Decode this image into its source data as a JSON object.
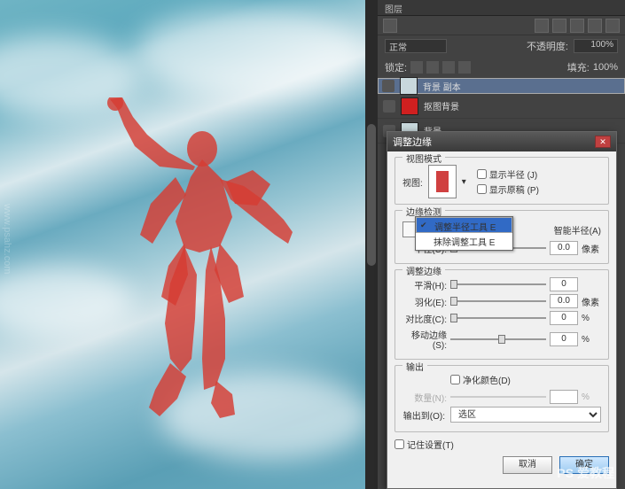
{
  "panel": {
    "tab": "图层",
    "blend_mode": "正常",
    "opacity_label": "不透明度:",
    "opacity_value": "100%",
    "lock_label": "锁定:",
    "fill_label": "填充:",
    "fill_value": "100%",
    "layers": [
      {
        "name": "背景 副本",
        "selected": true,
        "thumb": "#c8d8dc"
      },
      {
        "name": "抠图背景",
        "selected": false,
        "thumb": "#d02020"
      },
      {
        "name": "背景",
        "selected": false,
        "thumb": "#c8d8dc"
      }
    ]
  },
  "dialog": {
    "title": "调整边缘",
    "view": {
      "legend": "视图模式",
      "label": "视图:",
      "show_radius": "显示半径 (J)",
      "show_original": "显示原稿 (P)"
    },
    "detect": {
      "legend": "边缘检测",
      "tool_menu": [
        "调整半径工具   E",
        "抹除调整工具   E"
      ],
      "smart": "智能半径(A)",
      "radius_label": "半径(U):",
      "radius_value": "0.0",
      "radius_unit": "像素"
    },
    "adjust": {
      "legend": "调整边缘",
      "smooth_label": "平滑(H):",
      "smooth_value": "0",
      "feather_label": "羽化(E):",
      "feather_value": "0.0",
      "feather_unit": "像素",
      "contrast_label": "对比度(C):",
      "contrast_value": "0",
      "contrast_unit": "%",
      "shift_label": "移动边缘(S):",
      "shift_value": "0",
      "shift_unit": "%"
    },
    "output": {
      "legend": "输出",
      "decon": "净化颜色(D)",
      "amount_label": "数量(N):",
      "amount_unit": "%",
      "out_label": "输出到(O):",
      "out_value": "选区"
    },
    "remember": "记住设置(T)",
    "cancel": "取消",
    "ok": "确定"
  },
  "watermark": "PS 爱教程",
  "watermark_side": "www.psahz.com"
}
